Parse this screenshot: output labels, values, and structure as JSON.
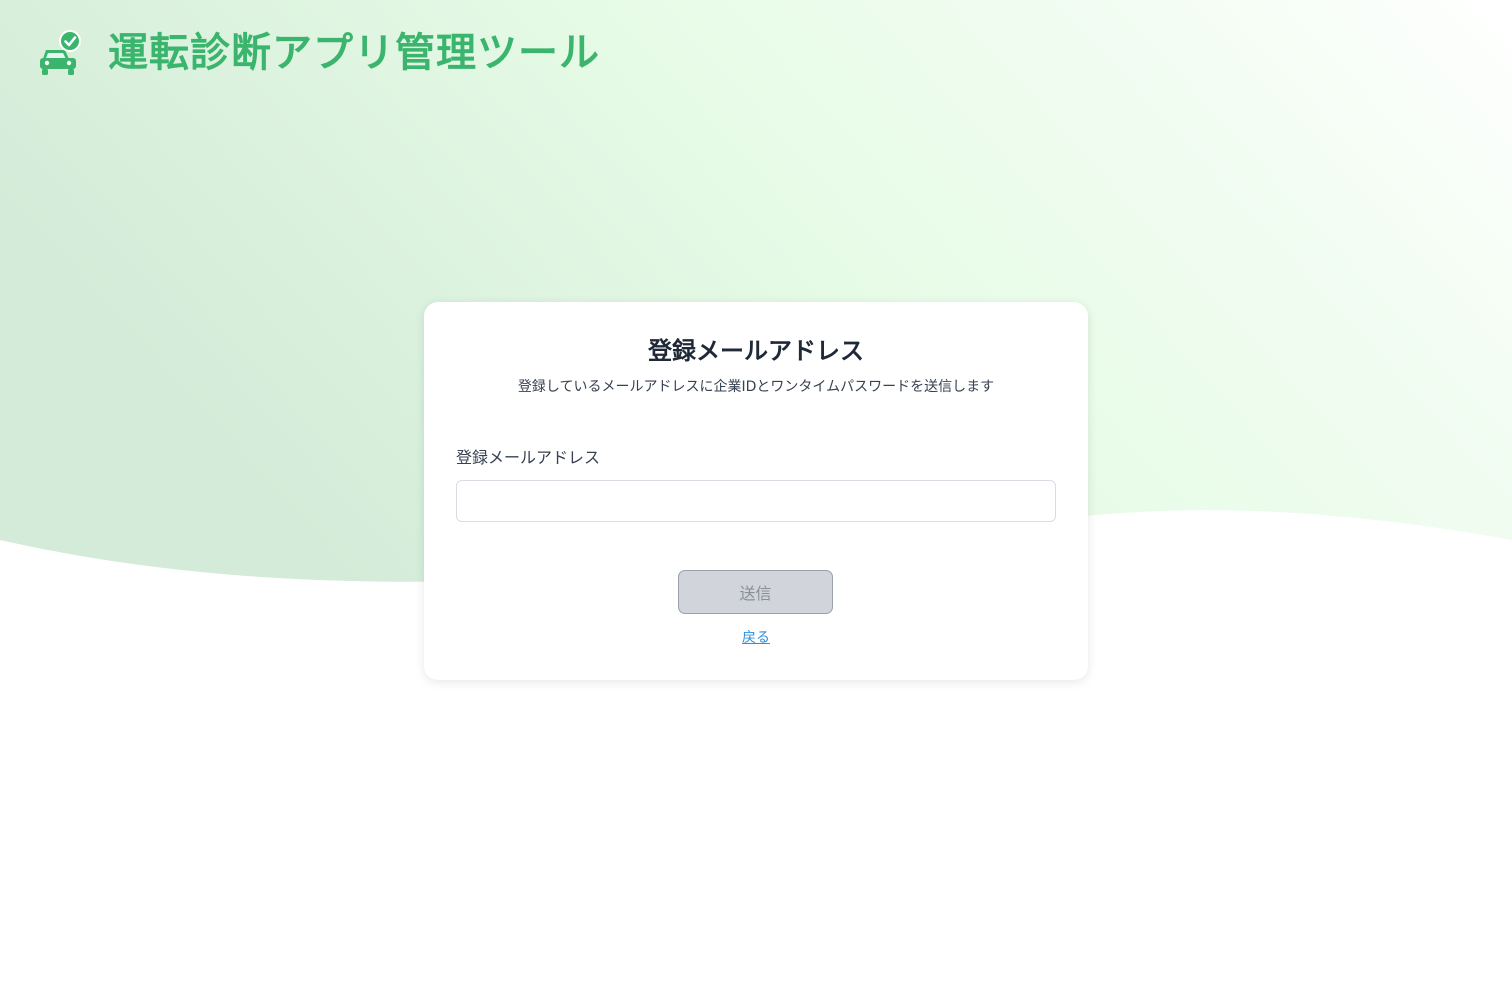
{
  "app": {
    "title": "運転診断アプリ管理ツール",
    "logo_icon": "car-check-icon"
  },
  "card": {
    "title": "登録メールアドレス",
    "subtitle": "登録しているメールアドレスに企業IDとワンタイムパスワードを送信します",
    "email_field": {
      "label": "登録メールアドレス",
      "value": "",
      "placeholder": ""
    },
    "submit_label": "送信",
    "back_label": "戻る"
  },
  "colors": {
    "brand_green": "#3bb56e",
    "background_green_light": "#e6fbe6",
    "background_green_dark": "#d3ecd9",
    "link_blue": "#2f8fd8",
    "button_disabled": "#d1d5db"
  }
}
